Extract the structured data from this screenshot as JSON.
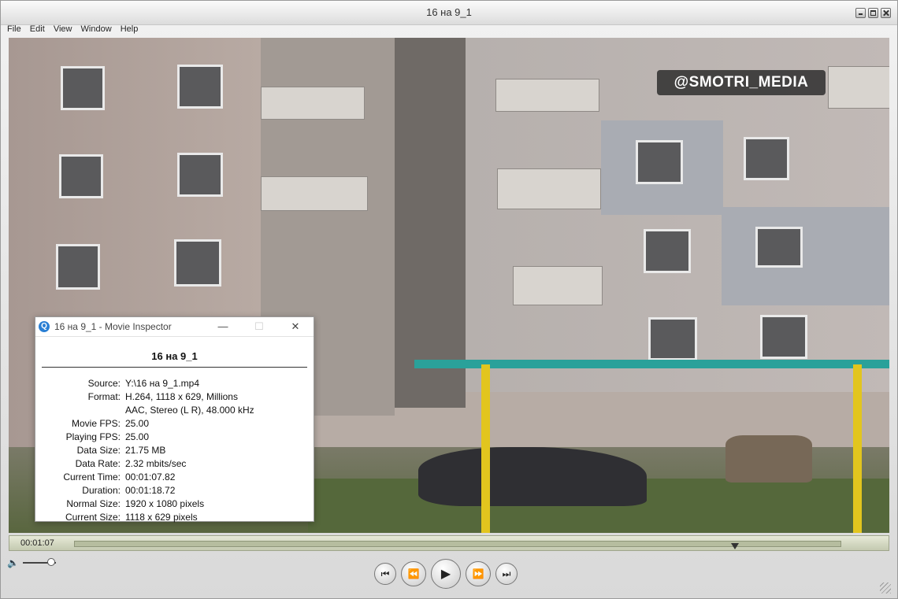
{
  "window": {
    "title": "16 на 9_1"
  },
  "menu": [
    "File",
    "Edit",
    "View",
    "Window",
    "Help"
  ],
  "video": {
    "watermark": "@SMOTRI_MEDIA"
  },
  "inspector": {
    "title": "16 на 9_1 - Movie Inspector",
    "movie_name": "16 на 9_1",
    "rows": [
      {
        "label": "Source:",
        "value": "Y:\\16 на 9_1.mp4"
      },
      {
        "label": "Format:",
        "value": "H.264, 1118 x 629, Millions"
      },
      {
        "label": "",
        "value": "AAC, Stereo (L R), 48.000 kHz"
      },
      {
        "label": "Movie FPS:",
        "value": "25.00"
      },
      {
        "label": "Playing FPS:",
        "value": "25.00"
      },
      {
        "label": "Data Size:",
        "value": "21.75 MB"
      },
      {
        "label": "Data Rate:",
        "value": "2.32 mbits/sec"
      },
      {
        "label": "Current Time:",
        "value": "00:01:07.82"
      },
      {
        "label": "Duration:",
        "value": "00:01:18.72"
      },
      {
        "label": "Normal Size:",
        "value": "1920 x 1080 pixels"
      },
      {
        "label": "Current Size:",
        "value": "1118 x 629 pixels"
      }
    ]
  },
  "controls": {
    "current_time": "00:01:07",
    "progress": 0.862,
    "volume": 0.85
  }
}
